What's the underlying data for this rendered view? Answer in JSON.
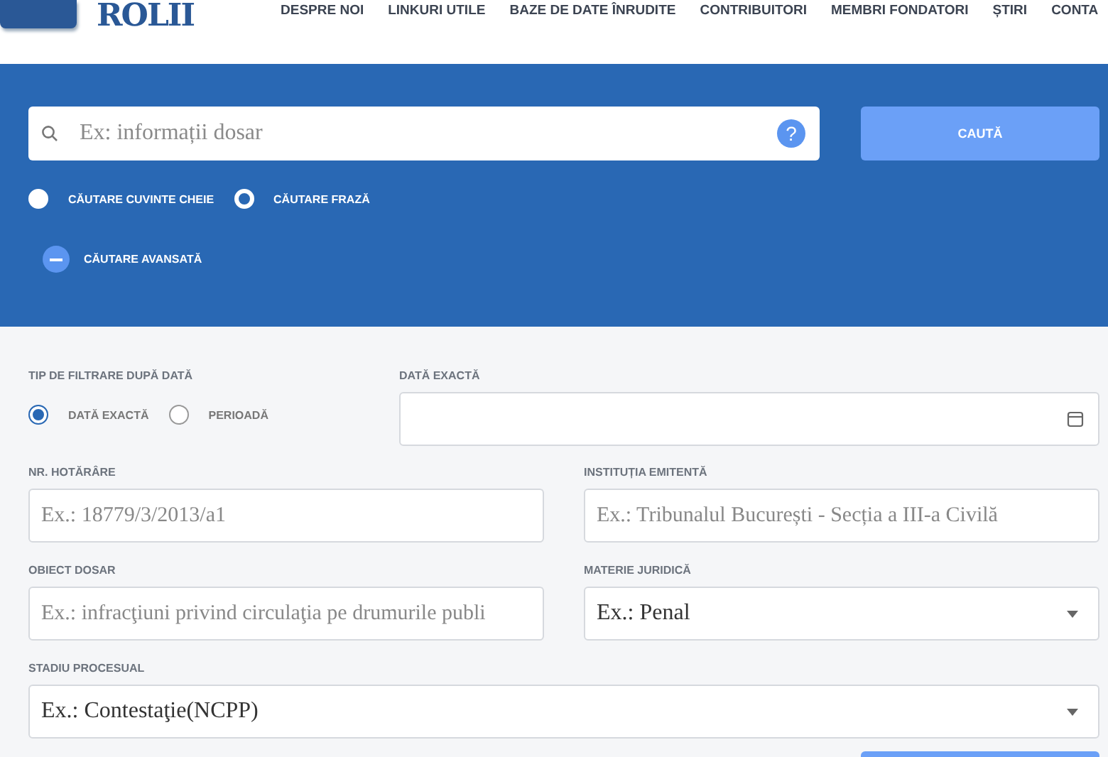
{
  "header": {
    "logo_text": "ROLII",
    "nav": [
      "DESPRE NOI",
      "LINKURI UTILE",
      "BAZE DE DATE ÎNRUDITE",
      "CONTRIBUITORI",
      "MEMBRI FONDATORI",
      "ȘTIRI",
      "CONTA"
    ]
  },
  "search": {
    "placeholder": "Ex: informații dosar",
    "help": "?",
    "button": "CAUTĂ",
    "modes": [
      {
        "label": "CĂUTARE CUVINTE CHEIE",
        "selected": false
      },
      {
        "label": "CĂUTARE FRAZĂ",
        "selected": true
      }
    ],
    "advanced": {
      "label": "CĂUTARE AVANSATĂ",
      "expanded": true
    }
  },
  "filters": {
    "date_type": {
      "label": "TIP DE FILTRARE DUPĂ DATĂ",
      "options": [
        {
          "label": "DATĂ EXACTĂ",
          "selected": true
        },
        {
          "label": "PERIOADĂ",
          "selected": false
        }
      ]
    },
    "exact_date": {
      "label": "DATĂ EXACTĂ"
    },
    "fields": [
      {
        "kind": "text",
        "label": "NR. HOTĂRÂRE",
        "placeholder": "Ex.: 18779/3/2013/a1"
      },
      {
        "kind": "text",
        "label": "INSTITUȚIA EMITENTĂ",
        "placeholder": "Ex.: Tribunalul București - Secția a III-a Civilă"
      },
      {
        "kind": "text",
        "label": "OBIECT DOSAR",
        "placeholder": "Ex.: infracţiuni privind circulaţia pe drumurile publi"
      },
      {
        "kind": "select",
        "label": "MATERIE JURIDICĂ",
        "value": "Ex.: Penal"
      },
      {
        "kind": "select",
        "label": "STADIU PROCESUAL",
        "value": "Ex.: Contestaţie(NCPP)",
        "wide": true
      }
    ]
  }
}
